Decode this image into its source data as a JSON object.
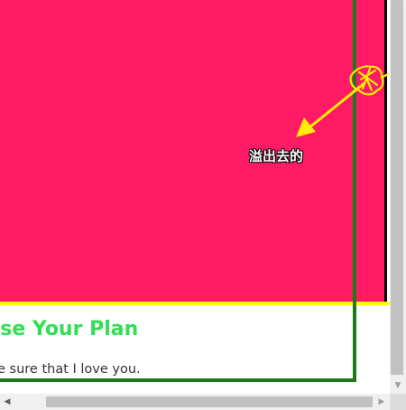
{
  "annotation": {
    "label": "溢出去的",
    "label_color": "#ffffff",
    "arrow_color": "#ffee00"
  },
  "plan": {
    "title": "oose Your Plan",
    "text": "e sure that I love you.",
    "title_color": "#33dd55"
  },
  "colors": {
    "card_background": "#ff1a66",
    "card_border": "#000000",
    "yellow_rule": "#ffff00",
    "green_frame": "#1a7a1a",
    "scrollbar_track": "#f0f0f0",
    "scrollbar_thumb": "#c1c1c1"
  },
  "icons": {
    "hand": "pointing-hand-icon",
    "scroll_left": "scroll-left-arrow-icon",
    "scroll_right": "scroll-right-arrow-icon",
    "scroll_down": "scroll-down-arrow-icon"
  }
}
